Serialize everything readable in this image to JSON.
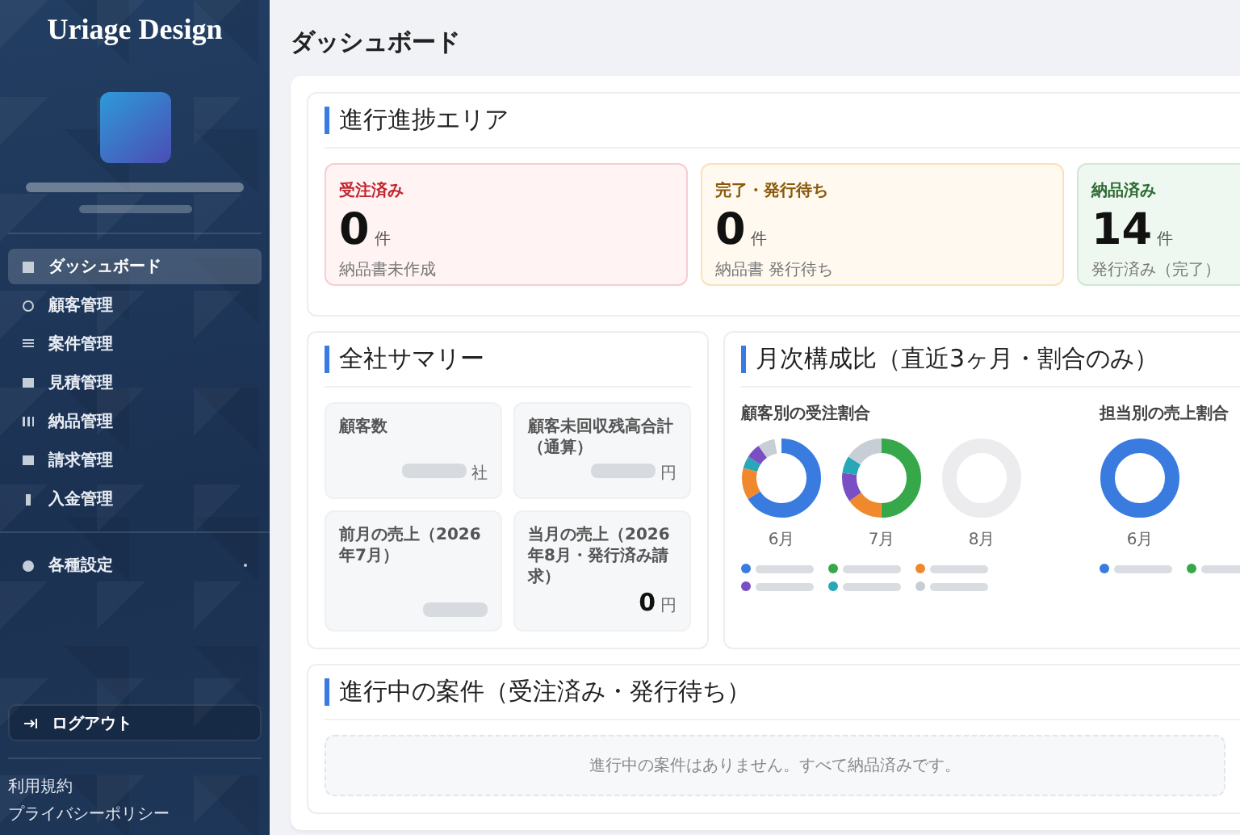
{
  "sidebar": {
    "logo": "Uriage Design",
    "nav": [
      {
        "label": "ダッシュボード",
        "selected": true
      },
      {
        "label": "顧客管理",
        "selected": false
      },
      {
        "label": "案件管理",
        "selected": false
      },
      {
        "label": "見積管理",
        "selected": false
      },
      {
        "label": "納品管理",
        "selected": false
      },
      {
        "label": "請求管理",
        "selected": false
      },
      {
        "label": "入金管理",
        "selected": false
      }
    ],
    "settings": {
      "label": "各種設定",
      "selected": false
    },
    "logout": "ログアウト",
    "footer_links": [
      "利用規約",
      "プライバシーポリシー"
    ]
  },
  "page_title": "ダッシュボード",
  "progress": {
    "title": "進行進捗エリア",
    "cards": [
      {
        "kind": "ordered",
        "label": "受注済み",
        "count": "0",
        "unit": "件",
        "note": "納品書未作成"
      },
      {
        "kind": "waiting",
        "label": "完了・発行待ち",
        "count": "0",
        "unit": "件",
        "note": "納品書 発行待ち"
      },
      {
        "kind": "delivered",
        "label": "納品済み",
        "count": "14",
        "unit": "件",
        "note": "発行済み（完了）"
      }
    ]
  },
  "summary": {
    "title": "全社サマリー",
    "tiles": [
      {
        "label": "顧客数",
        "unit": "社"
      },
      {
        "label": "顧客未回収残高合計（通算）",
        "unit": "円"
      },
      {
        "label": "前月の売上（2026年7月）"
      },
      {
        "label": "当月の売上（2026年8月・発行済み請求）",
        "value": "0",
        "unit": "円"
      }
    ]
  },
  "monthly": {
    "title": "月次構成比（直近3ヶ月・割合のみ）",
    "groups": [
      {
        "title": "顧客別の受注割合",
        "months": [
          "6月",
          "7月",
          "8月"
        ]
      },
      {
        "title": "担当別の売上割合",
        "months": [
          "6月"
        ]
      }
    ]
  },
  "ongoing": {
    "title": "進行中の案件（受注済み・発行待ち）",
    "empty_message": "進行中の案件はありません。すべて納品済みです。"
  }
}
